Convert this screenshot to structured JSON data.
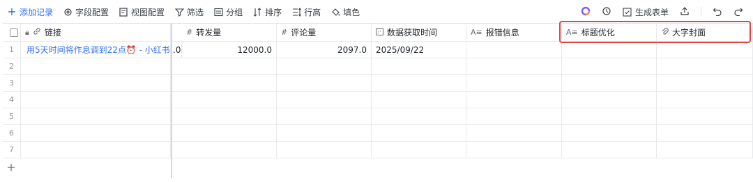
{
  "toolbar": {
    "add_record": "添加记录",
    "field_config": "字段配置",
    "view_config": "视图配置",
    "filter": "筛选",
    "group": "分组",
    "sort": "排序",
    "row_height": "行高",
    "fill_color": "填色",
    "generate_form": "生成表单"
  },
  "columns": {
    "link": "链接",
    "repost": "转发量",
    "comments": "评论量",
    "data_time": "数据获取时间",
    "error_info": "报错信息",
    "title_opt": "标题优化",
    "big_cover": "大字封面"
  },
  "rows": [
    {
      "num": "1",
      "link": "用5天时间将作息调到22点⏰ - 小红书",
      "partial": ".0",
      "repost": "12000.0",
      "comments": "2097.0",
      "date": "2025/09/22"
    },
    {
      "num": "2"
    },
    {
      "num": "3"
    },
    {
      "num": "4"
    },
    {
      "num": "5"
    },
    {
      "num": "6"
    },
    {
      "num": "7"
    }
  ],
  "colors": {
    "accent": "#3370ff",
    "highlight": "#e04443"
  }
}
